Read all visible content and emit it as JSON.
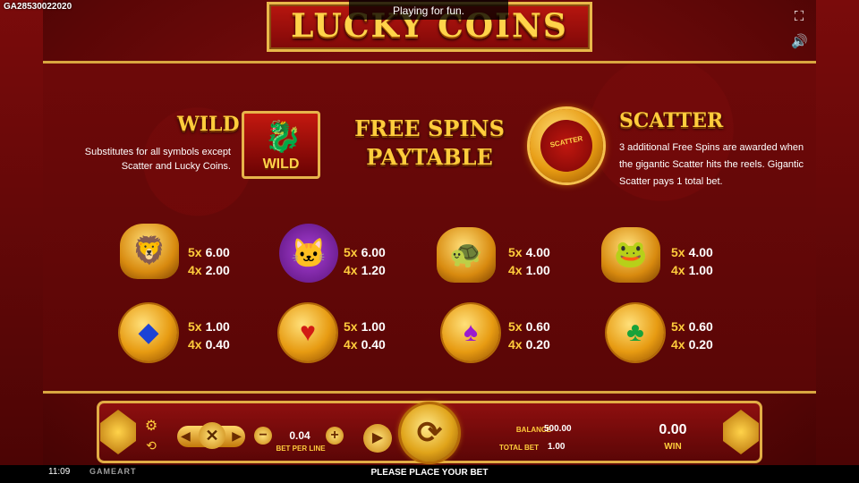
{
  "header": {
    "game_id": "GA28530022020",
    "fun_banner": "Playing for fun.",
    "logo": "LUCKY COINS",
    "fullscreen_icon": "fullscreen-icon",
    "sound_icon": "speaker-icon"
  },
  "wild": {
    "title": "WILD",
    "desc": "Substitutes for all symbols except Scatter and Lucky Coins.",
    "symbol_label": "WILD"
  },
  "free_spins": {
    "title": "FREE SPINS PAYTABLE"
  },
  "scatter": {
    "title": "SCATTER",
    "symbol_label": "SCATTER",
    "desc": "3 additional Free Spins are awarded when the gigantic Scatter hits the reels. Gigantic Scatter pays 1 total bet."
  },
  "paytable": [
    {
      "symbol": "gold-lion-icon",
      "r1": {
        "k": "5x",
        "v": "6.00"
      },
      "r2": {
        "k": "4x",
        "v": "2.00"
      }
    },
    {
      "symbol": "lucky-cat-icon",
      "r1": {
        "k": "5x",
        "v": "6.00"
      },
      "r2": {
        "k": "4x",
        "v": "1.20"
      }
    },
    {
      "symbol": "gold-turtle-icon",
      "r1": {
        "k": "5x",
        "v": "4.00"
      },
      "r2": {
        "k": "4x",
        "v": "1.00"
      }
    },
    {
      "symbol": "gold-toad-icon",
      "r1": {
        "k": "5x",
        "v": "4.00"
      },
      "r2": {
        "k": "4x",
        "v": "1.00"
      }
    },
    {
      "symbol": "diamond-coin-icon",
      "r1": {
        "k": "5x",
        "v": "1.00"
      },
      "r2": {
        "k": "4x",
        "v": "0.40"
      }
    },
    {
      "symbol": "heart-coin-icon",
      "r1": {
        "k": "5x",
        "v": "1.00"
      },
      "r2": {
        "k": "4x",
        "v": "0.40"
      }
    },
    {
      "symbol": "spade-coin-icon",
      "r1": {
        "k": "5x",
        "v": "0.60"
      },
      "r2": {
        "k": "4x",
        "v": "0.20"
      }
    },
    {
      "symbol": "club-coin-icon",
      "r1": {
        "k": "5x",
        "v": "0.60"
      },
      "r2": {
        "k": "4x",
        "v": "0.20"
      }
    }
  ],
  "controls": {
    "bet_value": "0.04",
    "bet_label": "BET PER LINE",
    "balance_label": "BALANCE",
    "balance_value": "500.00",
    "total_bet_label": "TOTAL BET",
    "total_bet_value": "1.00",
    "win_value": "0.00",
    "win_label": "WIN",
    "minus": "−",
    "plus": "+"
  },
  "footer": {
    "clock": "11:09",
    "brand": "GAMEART",
    "message": "PLEASE PLACE YOUR BET"
  },
  "colors": {
    "accent_gold": "#ffcc3c",
    "background_red": "#6e0a0a"
  }
}
